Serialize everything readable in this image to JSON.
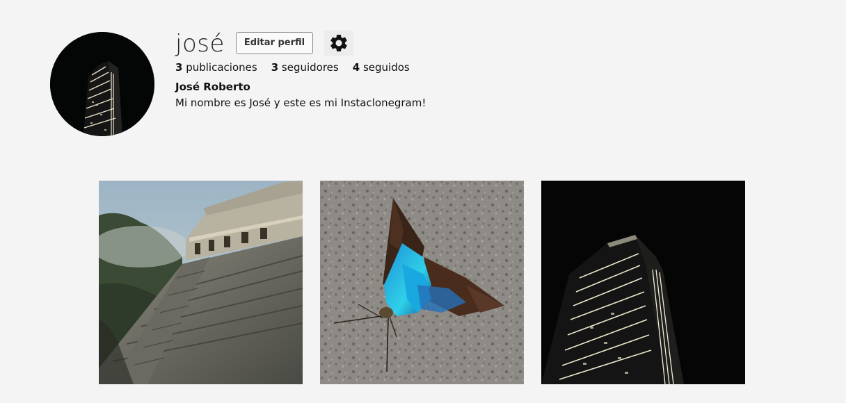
{
  "profile": {
    "username": "josé",
    "edit_label": "Editar perfil",
    "settings_icon": "gear-icon",
    "stats": [
      {
        "count": "3",
        "label": "publicaciones"
      },
      {
        "count": "3",
        "label": "seguidores"
      },
      {
        "count": "4",
        "label": "seguidos"
      }
    ],
    "full_name": "José Roberto",
    "bio": "Mi nombre es José y este es mi Instaclonegram!"
  },
  "posts": [
    {
      "subject": "pyramid-temple"
    },
    {
      "subject": "blue-butterfly"
    },
    {
      "subject": "night-skyscraper"
    }
  ]
}
